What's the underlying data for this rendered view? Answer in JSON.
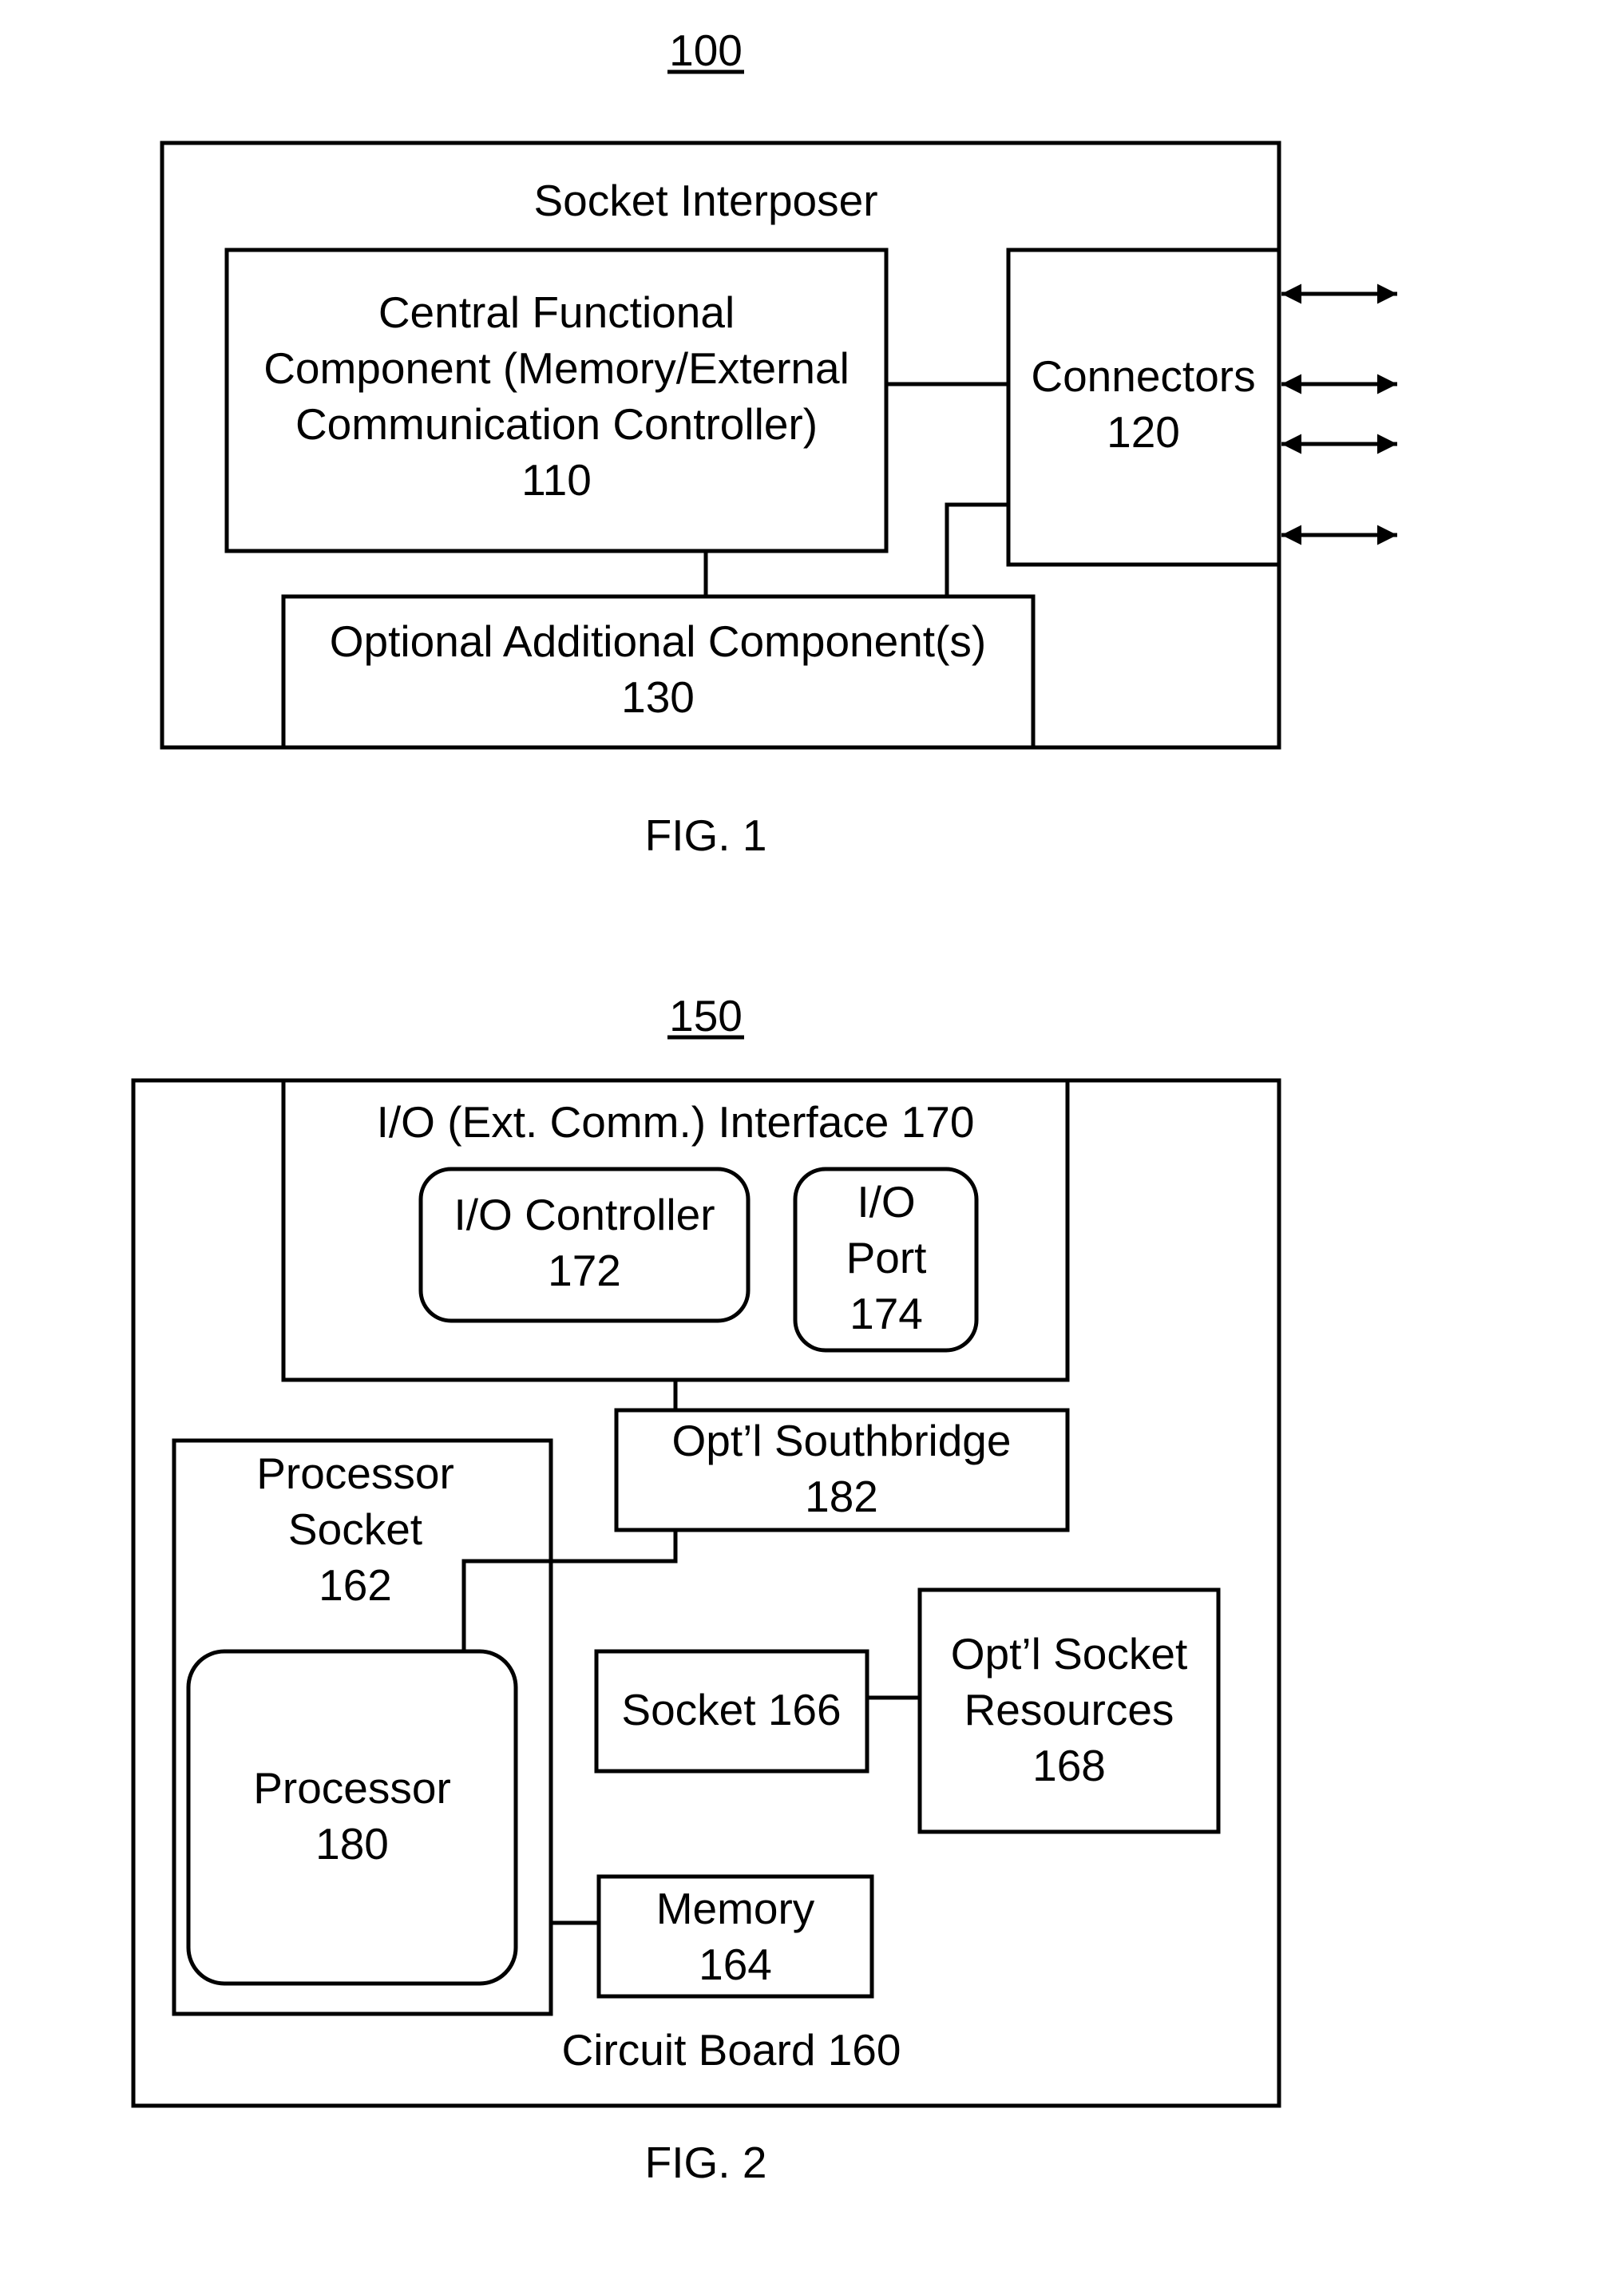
{
  "fig1": {
    "ref": "100",
    "caption": "FIG. 1",
    "socket_interposer": "Socket Interposer",
    "central": [
      "Central Functional",
      "Component (Memory/External",
      "Communication Controller)",
      "110"
    ],
    "connectors": [
      "Connectors",
      "120"
    ],
    "optional": [
      "Optional Additional Component(s)",
      "130"
    ]
  },
  "fig2": {
    "ref": "150",
    "caption": "FIG. 2",
    "io_interface": "I/O (Ext. Comm.) Interface 170",
    "io_controller": [
      "I/O Controller",
      "172"
    ],
    "io_port": [
      "I/O",
      "Port",
      "174"
    ],
    "southbridge": [
      "Opt’l Southbridge",
      "182"
    ],
    "processor_socket": [
      "Processor",
      "Socket",
      "162"
    ],
    "processor": [
      "Processor",
      "180"
    ],
    "socket166": "Socket 166",
    "socket_resources": [
      "Opt’l Socket",
      "Resources",
      "168"
    ],
    "memory": [
      "Memory",
      "164"
    ],
    "circuit_board": "Circuit Board 160"
  }
}
